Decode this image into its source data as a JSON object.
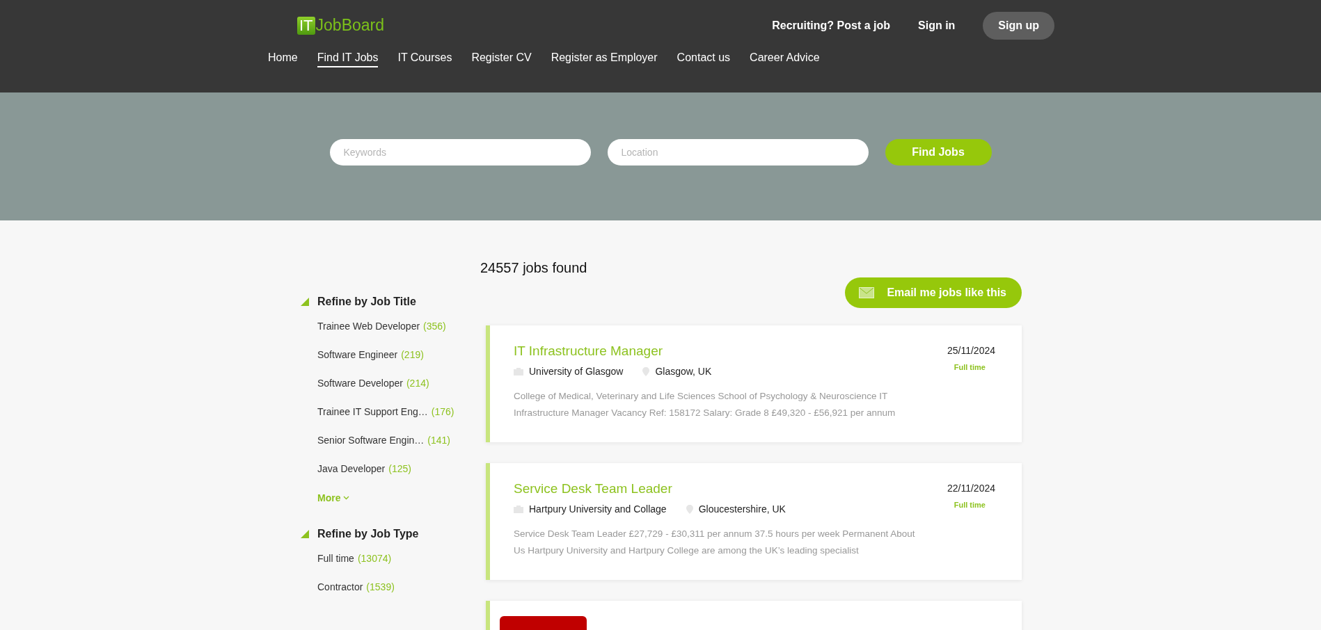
{
  "logo": {
    "badge": "IT",
    "name": "JobBoard"
  },
  "header_links": [
    {
      "label": "Recruiting? Post a job",
      "kind": "link"
    },
    {
      "label": "Sign in",
      "kind": "link"
    },
    {
      "label": "Sign up",
      "kind": "button"
    }
  ],
  "nav": [
    {
      "label": "Home",
      "selected": false
    },
    {
      "label": "Find IT Jobs",
      "selected": true
    },
    {
      "label": "IT Courses",
      "selected": false
    },
    {
      "label": "Register CV",
      "selected": false
    },
    {
      "label": "Register as Employer",
      "selected": false
    },
    {
      "label": "Contact us",
      "selected": false
    },
    {
      "label": "Career Advice",
      "selected": false
    }
  ],
  "search": {
    "keywords_placeholder": "Keywords",
    "location_placeholder": "Location",
    "button": "Find Jobs"
  },
  "results_count": "24557 jobs found",
  "email_button": "Email me jobs like this",
  "filters": [
    {
      "title": "Refine by Job Title",
      "expanded": true,
      "more": "More",
      "items": [
        {
          "label": "Trainee Web Developer",
          "count": "(356)"
        },
        {
          "label": "Software Engineer",
          "count": "(219)"
        },
        {
          "label": "Software Developer",
          "count": "(214)"
        },
        {
          "label": "Trainee IT Support Eng…",
          "count": "(176)"
        },
        {
          "label": "Senior Software Engin…",
          "count": "(141)"
        },
        {
          "label": "Java Developer",
          "count": "(125)"
        }
      ]
    },
    {
      "title": "Refine by Job Type",
      "expanded": true,
      "items": [
        {
          "label": "Full time",
          "count": "(13074)"
        },
        {
          "label": "Contractor",
          "count": "(1539)"
        }
      ]
    }
  ],
  "jobs": [
    {
      "kind": "full",
      "title": "IT Infrastructure Manager",
      "company": "University of Glasgow",
      "location": "Glasgow, UK",
      "date": "25/11/2024",
      "type": "Full time",
      "description": "College of Medical, Veterinary and Life Sciences School of Psychology & Neuroscience   IT Infrastructure Manager Vacancy Ref: 158172 Salary: Grade 8 £49,320 - £56,921 per annum"
    },
    {
      "kind": "full",
      "title": "Service Desk Team Leader",
      "company": "Hartpury University and Collage",
      "location": "Gloucestershire, UK",
      "date": "22/11/2024",
      "type": "Full time",
      "description": "Service Desk Team Leader £27,729 - £30,311 per annum 37.5 hours per week Permanent About Us Hartpury University and Hartpury College are among the UK’s leading specialist"
    },
    {
      "kind": "cut"
    }
  ]
}
